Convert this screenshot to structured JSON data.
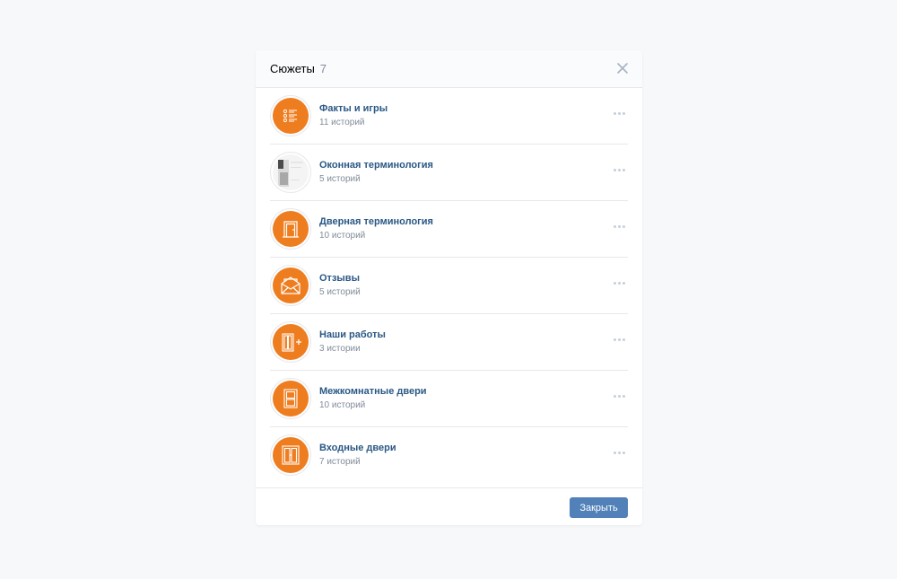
{
  "modal": {
    "title": "Сюжеты",
    "count": "7",
    "close_icon": "close-icon"
  },
  "items": [
    {
      "title": "Факты и игры",
      "subtitle": "11 историй",
      "icon": "checklist-icon"
    },
    {
      "title": "Оконная терминология",
      "subtitle": "5 историй",
      "icon": "window-photo"
    },
    {
      "title": "Дверная терминология",
      "subtitle": "10 историй",
      "icon": "door-icon"
    },
    {
      "title": "Отзывы",
      "subtitle": "5 историй",
      "icon": "envelope-icon"
    },
    {
      "title": "Наши работы",
      "subtitle": "3 истории",
      "icon": "door-plus-icon"
    },
    {
      "title": "Межкомнатные двери",
      "subtitle": "10 историй",
      "icon": "interior-door-icon"
    },
    {
      "title": "Входные двери",
      "subtitle": "7 историй",
      "icon": "double-door-icon"
    }
  ],
  "footer": {
    "close_label": "Закрыть"
  },
  "colors": {
    "accent": "#ee7d1f",
    "link": "#2a5885",
    "button": "#5181b8"
  }
}
